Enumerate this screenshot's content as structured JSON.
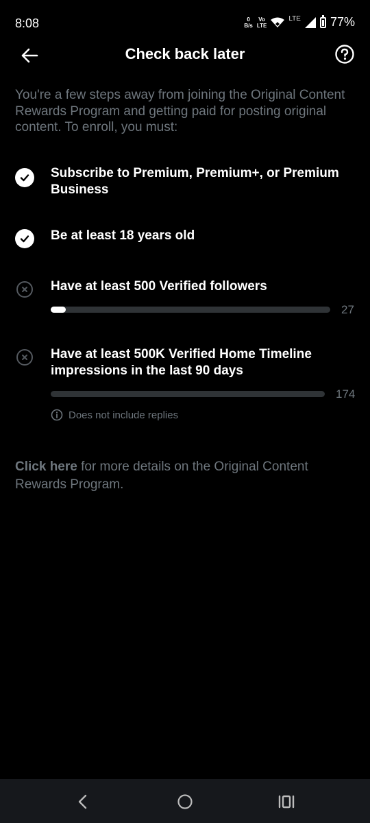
{
  "status_bar": {
    "time": "8:08",
    "net_speed_top": "0",
    "net_speed_unit": "B/s",
    "volte_top": "Vo",
    "volte_bottom": "LTE",
    "lte": "LTE",
    "battery": "77%"
  },
  "header": {
    "title": "Check back later",
    "back_icon": "arrow-left-icon",
    "help_icon": "question-circle-icon"
  },
  "intro": "You're a few steps away from joining the Original Content Rewards Program and getting paid for posting original content. To enroll, you must:",
  "requirements": [
    {
      "label": "Subscribe to Premium, Premium+, or Premium Business",
      "status": "complete",
      "icon": "check-circle-icon"
    },
    {
      "label": "Be at least 18 years old",
      "status": "complete",
      "icon": "check-circle-icon"
    },
    {
      "label": "Have at least 500 Verified followers",
      "status": "incomplete",
      "icon": "x-circle-icon",
      "progress": {
        "current": 27,
        "target": 500,
        "display": "27"
      }
    },
    {
      "label": "Have at least 500K Verified Home Timeline impressions in the last 90 days",
      "status": "incomplete",
      "icon": "x-circle-icon",
      "progress": {
        "current": 174,
        "target": 500000,
        "display": "174"
      }
    }
  ],
  "note": {
    "icon": "info-circle-icon",
    "text": "Does not include replies"
  },
  "footer": {
    "link_text": "Click here",
    "rest_text": " for more details on the Original Content Rewards Program."
  },
  "nav_bar": {
    "back_icon": "nav-back-icon",
    "home_icon": "nav-home-icon",
    "recents_icon": "nav-recents-icon"
  },
  "colors": {
    "background": "#000000",
    "muted_text": "#6e767d",
    "track": "#2f3336",
    "fill": "#ffffff"
  }
}
